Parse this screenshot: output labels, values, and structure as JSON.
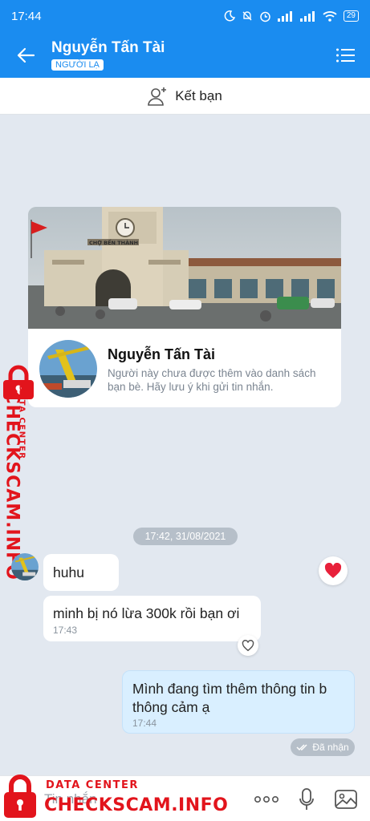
{
  "status_bar": {
    "time": "17:44",
    "battery": "29"
  },
  "header": {
    "contact_name": "Nguyễn Tấn Tài",
    "badge": "NGƯỜI LẠ"
  },
  "add_friend": {
    "label": "Kết bạn"
  },
  "profile_card": {
    "name": "Nguyễn Tấn Tài",
    "description": "Người này chưa được thêm vào danh sách bạn bè. Hãy lưu ý khi gửi tin nhắn.",
    "cover_sign": "CHỢ BẾN THÀNH"
  },
  "watermark": {
    "data_center": "DATA CENTER",
    "brand": "CHECKSCAM.INFO"
  },
  "chat": {
    "date_divider": "17:42, 31/08/2021",
    "messages": [
      {
        "direction": "in",
        "text": "huhu",
        "time": ""
      },
      {
        "direction": "in",
        "text": "minh bị nó lừa 300k rồi bạn ơi",
        "time": "17:43"
      },
      {
        "direction": "out",
        "text": "Mình đang tìm thêm thông tin b thông cảm ạ",
        "time": "17:44"
      }
    ],
    "delivery_status": "Đã nhận"
  },
  "input": {
    "placeholder": "Tin nhắn"
  },
  "colors": {
    "brand_blue": "#1a8cf0",
    "out_bubble": "#d9efff",
    "watermark_red": "#e2141c",
    "heart": "#e8203a"
  },
  "icons": [
    "back-arrow-icon",
    "list-menu-icon",
    "add-user-icon",
    "heart-icon",
    "heart-outline-icon",
    "double-check-icon",
    "more-dots-icon",
    "mic-icon",
    "image-icon",
    "lock-icon"
  ]
}
